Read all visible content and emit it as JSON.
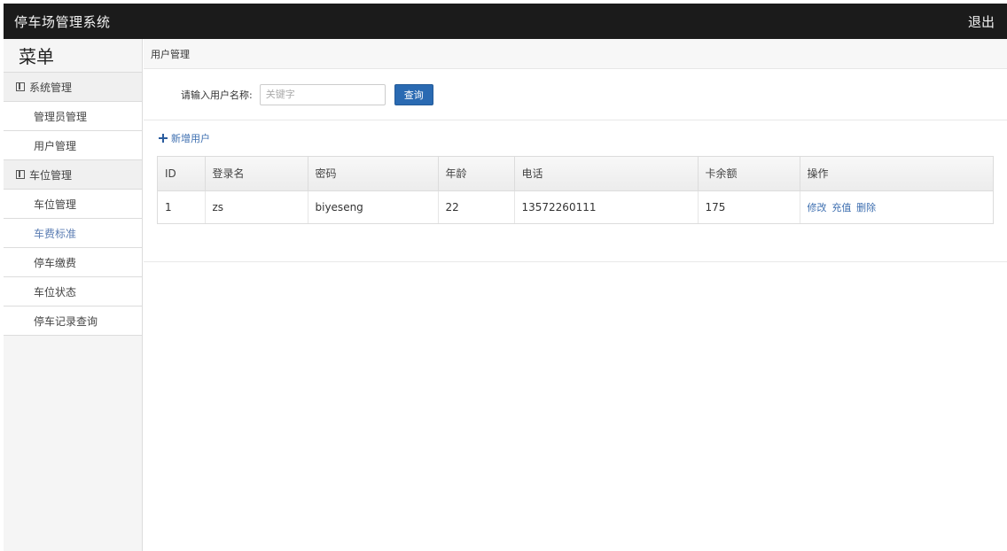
{
  "header": {
    "app_title": "停车场管理系统",
    "logout_label": "退出"
  },
  "sidebar": {
    "menu_title": "菜单",
    "groups": [
      {
        "label": "系统管理",
        "items": [
          "管理员管理",
          "用户管理"
        ]
      },
      {
        "label": "车位管理",
        "items": [
          "车位管理",
          "车费标准",
          "停车缴费",
          "车位状态",
          "停车记录查询"
        ]
      }
    ],
    "active_item": "车费标准"
  },
  "main": {
    "breadcrumb": "用户管理",
    "search": {
      "label": "请输入用户名称:",
      "placeholder": "关键字",
      "value": "",
      "button_label": "查询"
    },
    "add_user_label": "新增用户",
    "table": {
      "columns": [
        "ID",
        "登录名",
        "密码",
        "年龄",
        "电话",
        "卡余额",
        "操作"
      ],
      "rows": [
        {
          "id": "1",
          "login": "zs",
          "password": "biyeseng",
          "age": "22",
          "phone": "13572260111",
          "balance": "175",
          "actions": [
            "修改",
            "充值",
            "删除"
          ]
        }
      ]
    }
  },
  "colors": {
    "topbar_bg": "#1b1b1b",
    "primary_button": "#2a6ab2",
    "link": "#3e6fb0"
  }
}
